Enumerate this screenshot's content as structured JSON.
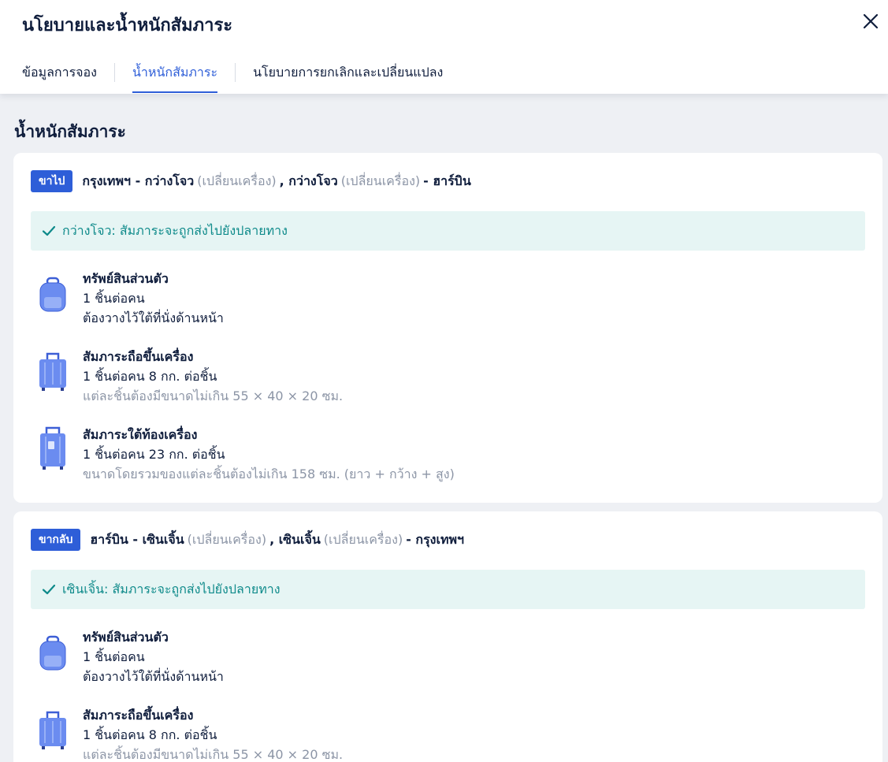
{
  "modal": {
    "title": "นโยบายและน้ำหนักสัมภาระ",
    "close_icon": "close-icon"
  },
  "tabs": [
    {
      "label": "ข้อมูลการจอง",
      "active": false
    },
    {
      "label": "น้ำหนักสัมภาระ",
      "active": true
    },
    {
      "label": "นโยบายการยกเลิกและเปลี่ยนแปลง",
      "active": false
    }
  ],
  "section": {
    "title": "น้ำหนักสัมภาระ"
  },
  "colors": {
    "accent": "#2e5ed8",
    "notice_bg": "#e6f5f4",
    "notice_text": "#0e8a8a",
    "muted": "#8c95a6"
  },
  "segments": [
    {
      "badge": "ขาไป",
      "route": {
        "from": "กรุงเทพฯ - กว่างโจว",
        "stop1_note": "(เปลี่ยนเครื่อง)",
        "mid": ", กว่างโจว",
        "stop2_note": "(เปลี่ยนเครื่อง)",
        "to": "- ฮาร์บิน"
      },
      "notice": "กว่างโจว: สัมภาระจะถูกส่งไปยังปลายทาง",
      "items": [
        {
          "icon": "backpack-icon",
          "title": "ทรัพย์สินส่วนตัว",
          "line1": "1 ชิ้นต่อคน",
          "line2": "ต้องวางไว้ใต้ที่นั่งด้านหน้า"
        },
        {
          "icon": "carry-on-suitcase-icon",
          "title": "สัมภาระถือขึ้นเครื่อง",
          "line1": "1 ชิ้นต่อคน 8 กก. ต่อชิ้น",
          "line2": "แต่ละชิ้นต้องมีขนาดไม่เกิน 55 × 40 × 20 ซม."
        },
        {
          "icon": "checked-suitcase-icon",
          "title": "สัมภาระใต้ท้องเครื่อง",
          "line1": "1 ชิ้นต่อคน 23 กก. ต่อชิ้น",
          "line2": "ขนาดโดยรวมของแต่ละชิ้นต้องไม่เกิน 158 ซม. (ยาว + กว้าง + สูง)"
        }
      ]
    },
    {
      "badge": "ขากลับ",
      "route": {
        "from": "ฮาร์บิน - เซินเจิ้น",
        "stop1_note": "(เปลี่ยนเครื่อง)",
        "mid": ", เซินเจิ้น",
        "stop2_note": "(เปลี่ยนเครื่อง)",
        "to": "- กรุงเทพฯ"
      },
      "notice": "เซินเจิ้น: สัมภาระจะถูกส่งไปยังปลายทาง",
      "items": [
        {
          "icon": "backpack-icon",
          "title": "ทรัพย์สินส่วนตัว",
          "line1": "1 ชิ้นต่อคน",
          "line2": "ต้องวางไว้ใต้ที่นั่งด้านหน้า"
        },
        {
          "icon": "carry-on-suitcase-icon",
          "title": "สัมภาระถือขึ้นเครื่อง",
          "line1": "1 ชิ้นต่อคน 8 กก. ต่อชิ้น",
          "line2": "แต่ละชิ้นต้องมีขนาดไม่เกิน 55 × 40 × 20 ซม."
        }
      ]
    }
  ]
}
